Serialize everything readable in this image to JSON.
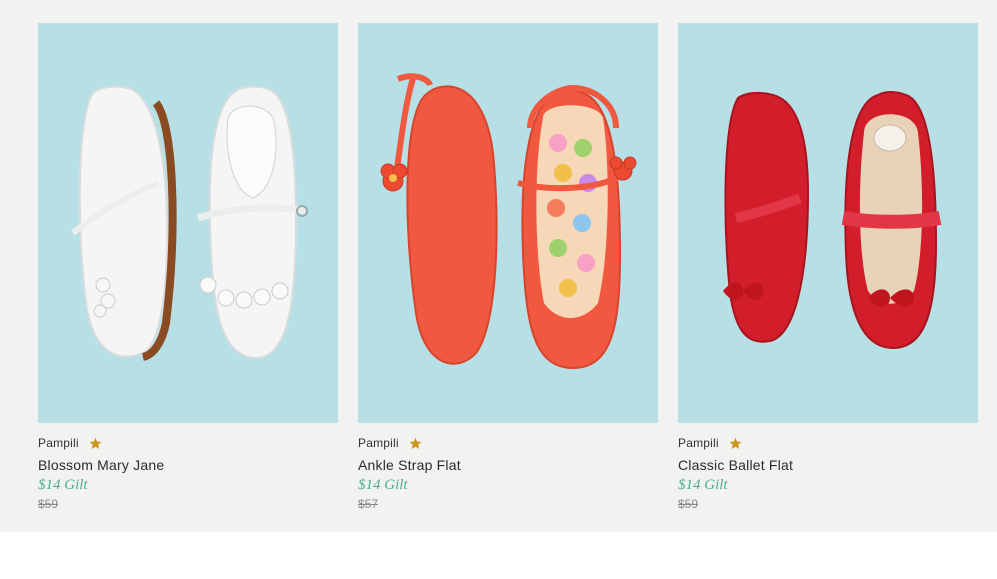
{
  "products": [
    {
      "brand": "Pampili",
      "name": "Blossom Mary Jane",
      "sale_price": "$14 Gilt",
      "original_price": "$59",
      "image_icon": "white-mary-jane-shoes-image",
      "shoe_color": "#f4f5f4"
    },
    {
      "brand": "Pampili",
      "name": "Ankle Strap Flat",
      "sale_price": "$14 Gilt",
      "original_price": "$57",
      "image_icon": "coral-ankle-strap-shoes-image",
      "shoe_color": "#f0583f"
    },
    {
      "brand": "Pampili",
      "name": "Classic Ballet Flat",
      "sale_price": "$14 Gilt",
      "original_price": "$59",
      "image_icon": "red-ballet-flat-shoes-image",
      "shoe_color": "#d21e2b"
    }
  ],
  "colors": {
    "background": "#f2f2f0",
    "photo_bg": "#b7dfe6",
    "price_green": "#4fae94",
    "star_gold": "#c9961a"
  }
}
